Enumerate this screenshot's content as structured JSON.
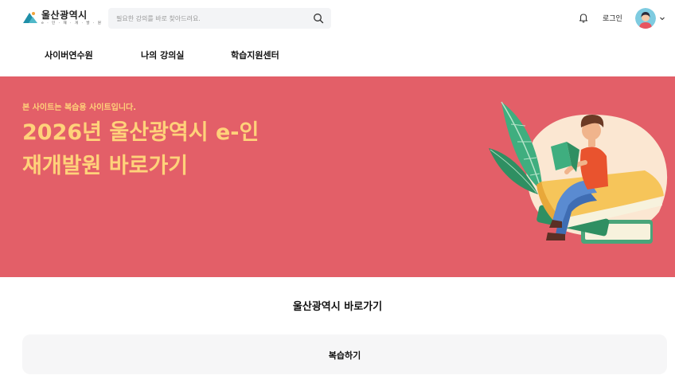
{
  "header": {
    "logo_title": "울산광역시",
    "logo_subtitle": "e · 인 · 재 · 개 · 발 · 원",
    "search_placeholder": "필요한 강의를 바로 찾아드려요.",
    "login_label": "로그인"
  },
  "icons": {
    "logo": "ulsan-logo-mark",
    "search": "search-icon",
    "bell": "bell-icon",
    "avatar": "avatar",
    "chevron": "chevron-down-icon"
  },
  "nav": {
    "items": [
      {
        "label": "사이버연수원"
      },
      {
        "label": "나의 강의실"
      },
      {
        "label": "학습지원센터"
      }
    ]
  },
  "hero": {
    "notice": "본 사이트는 복습용 사이트입니다.",
    "title": "2026년 울산광역시 e-인재개발원 바로가기",
    "background_color": "#e35f68",
    "accent_color": "#ffd27a"
  },
  "section": {
    "title": "울산광역시 바로가기"
  },
  "cards": [
    {
      "label": "복습하기"
    }
  ]
}
